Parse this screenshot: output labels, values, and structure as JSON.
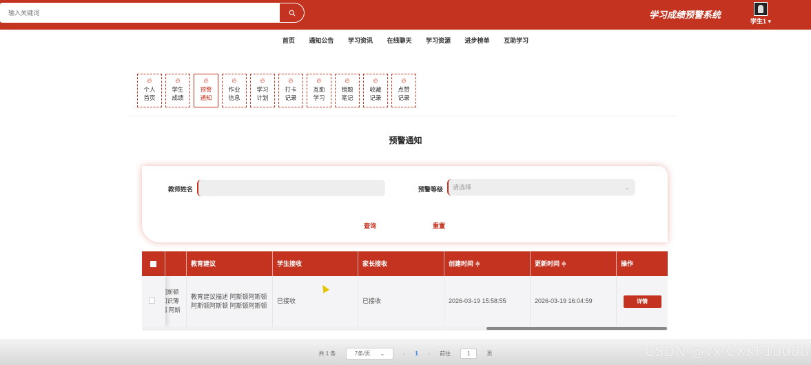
{
  "header": {
    "search_placeholder": "输入关键词",
    "title": "学习成绩预警系统",
    "user_name": "学生1"
  },
  "nav": [
    "首页",
    "通知公告",
    "学习资讯",
    "在线聊天",
    "学习资源",
    "进步榜单",
    "互助学习"
  ],
  "tabs": [
    {
      "line1": "个人",
      "line2": "首页"
    },
    {
      "line1": "学生",
      "line2": "成绩"
    },
    {
      "line1": "预警",
      "line2": "通知"
    },
    {
      "line1": "作业",
      "line2": "信息"
    },
    {
      "line1": "学习",
      "line2": "计划"
    },
    {
      "line1": "打卡",
      "line2": "记录"
    },
    {
      "line1": "互助",
      "line2": "学习"
    },
    {
      "line1": "错题",
      "line2": "笔记"
    },
    {
      "line1": "收藏",
      "line2": "记录"
    },
    {
      "line1": "点赞",
      "line2": "记录"
    }
  ],
  "active_tab": "预警通知",
  "page_title": "预警通知",
  "filter": {
    "teacher_label": "教师姓名",
    "level_label": "预警等级",
    "level_placeholder": "请选择",
    "query_label": "查询",
    "reset_label": "重置"
  },
  "table": {
    "headers": {
      "advice": "教育建议",
      "student_received": "学生接收",
      "parent_received": "家长接收",
      "created": "创建时间 ≑",
      "updated": "更新时间 ≑",
      "ops": "操作"
    },
    "rows": [
      {
        "hidden_col_l1": "阿斯顿",
        "hidden_col_l2": "知识薄",
        "hidden_col_l3": "弱 阿斯",
        "advice_l1": "教育建议描述 阿斯顿阿斯顿",
        "advice_l2": "阿斯顿阿斯顿 阿斯顿阿斯顿",
        "student_received": "已接收",
        "parent_received": "已接收",
        "created": "2026-03-19 15:58:55",
        "updated": "2026-03-19 16:04:59",
        "detail_label": "详情"
      }
    ]
  },
  "pager": {
    "total": "共 1 条",
    "page_size": "7条/页",
    "current": "1",
    "goto_label": "前往",
    "goto_value": "1",
    "page_suffix": "页"
  },
  "watermark": "CSDN @vx  CXKF10088",
  "colors": {
    "brand": "#c43320",
    "link": "#1e7fe0"
  }
}
